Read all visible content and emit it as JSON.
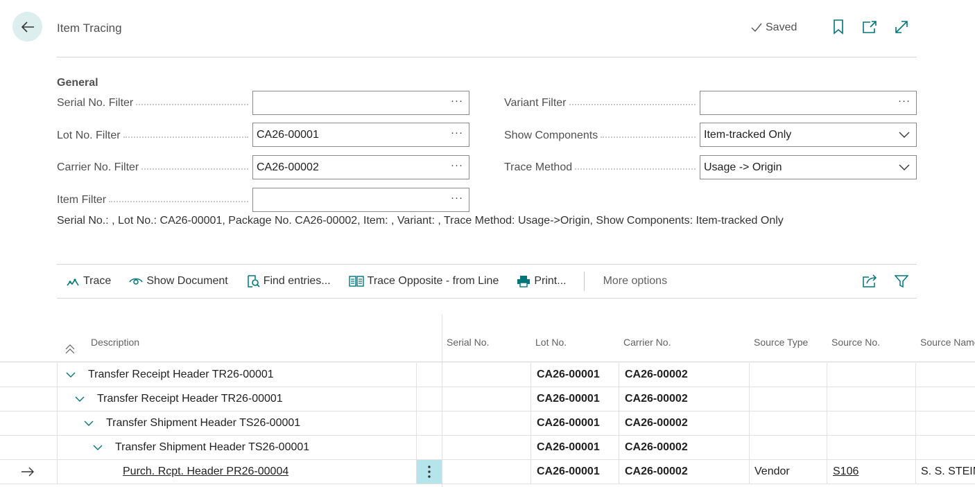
{
  "header": {
    "title": "Item Tracing",
    "saved_label": "Saved"
  },
  "general": {
    "section_title": "General",
    "fields": {
      "serial_no_filter": {
        "label": "Serial No. Filter",
        "value": ""
      },
      "lot_no_filter": {
        "label": "Lot No. Filter",
        "value": "CA26-00001"
      },
      "carrier_no_filter": {
        "label": "Carrier No. Filter",
        "value": "CA26-00002"
      },
      "item_filter": {
        "label": "Item Filter",
        "value": ""
      },
      "variant_filter": {
        "label": "Variant Filter",
        "value": ""
      },
      "show_components": {
        "label": "Show Components",
        "value": "Item-tracked Only"
      },
      "trace_method": {
        "label": "Trace Method",
        "value": "Usage -> Origin"
      }
    },
    "summary": "Serial No.: , Lot No.: CA26-00001, Package No. CA26-00002, Item: , Variant: , Trace Method: Usage->Origin, Show Components: Item-tracked Only"
  },
  "actions": {
    "trace": "Trace",
    "show_document": "Show Document",
    "find_entries": "Find entries...",
    "trace_opposite": "Trace Opposite - from Line",
    "print": "Print...",
    "more_options": "More options"
  },
  "grid": {
    "columns": {
      "description": "Description",
      "serial_no": "Serial No.",
      "lot_no": "Lot No.",
      "carrier_no": "Carrier No.",
      "source_type": "Source Type",
      "source_no": "Source No.",
      "source_name": "Source Name"
    },
    "rows": [
      {
        "description": "Transfer Receipt Header TR26-00001",
        "serial_no": "",
        "lot_no": "CA26-00001",
        "carrier_no": "CA26-00002",
        "source_type": "",
        "source_no": "",
        "source_name": ""
      },
      {
        "description": "Transfer Receipt Header TR26-00001",
        "serial_no": "",
        "lot_no": "CA26-00001",
        "carrier_no": "CA26-00002",
        "source_type": "",
        "source_no": "",
        "source_name": ""
      },
      {
        "description": "Transfer Shipment Header TS26-00001",
        "serial_no": "",
        "lot_no": "CA26-00001",
        "carrier_no": "CA26-00002",
        "source_type": "",
        "source_no": "",
        "source_name": ""
      },
      {
        "description": "Transfer Shipment Header TS26-00001",
        "serial_no": "",
        "lot_no": "CA26-00001",
        "carrier_no": "CA26-00002",
        "source_type": "",
        "source_no": "",
        "source_name": ""
      },
      {
        "description": "Purch. Rcpt. Header PR26-00004",
        "serial_no": "",
        "lot_no": "CA26-00001",
        "carrier_no": "CA26-00002",
        "source_type": "Vendor",
        "source_no": "S106",
        "source_name": "S. S. STEIN"
      }
    ]
  },
  "colors": {
    "accent": "#00757a",
    "selected_cell": "#b5e5ea",
    "back_button_bg": "#dcefee"
  }
}
